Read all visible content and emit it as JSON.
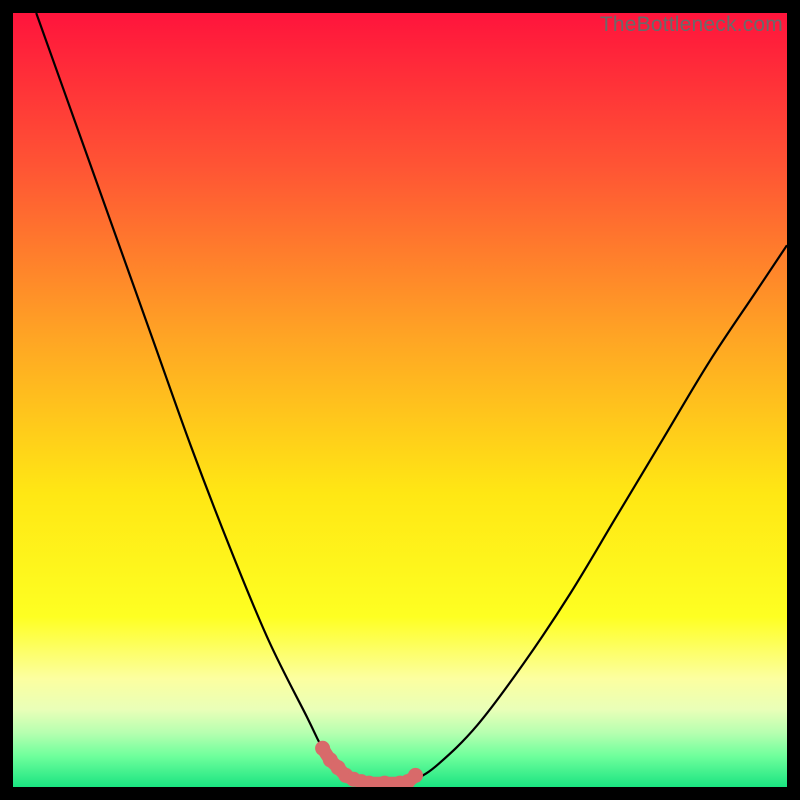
{
  "watermark": "TheBottleneck.com",
  "chart_data": {
    "type": "line",
    "title": "",
    "xlabel": "",
    "ylabel": "",
    "xlim": [
      0,
      100
    ],
    "ylim": [
      0,
      100
    ],
    "grid": false,
    "series": [
      {
        "name": "bottleneck-curve",
        "x": [
          3,
          8,
          13,
          18,
          23,
          28,
          33,
          38,
          40,
          42,
          44,
          46,
          48,
          50,
          52,
          55,
          60,
          66,
          72,
          78,
          84,
          90,
          96,
          100
        ],
        "y": [
          100,
          86,
          72,
          58,
          44,
          31,
          19,
          9,
          5,
          2.5,
          1,
          0.5,
          0.5,
          0.5,
          1,
          3,
          8,
          16,
          25,
          35,
          45,
          55,
          64,
          70
        ]
      }
    ],
    "highlight": {
      "name": "optimal-range",
      "x": [
        40,
        41,
        42,
        43,
        44,
        45,
        46,
        48,
        50,
        51,
        52
      ],
      "y": [
        5,
        3.5,
        2.5,
        1.5,
        1,
        0.7,
        0.5,
        0.5,
        0.5,
        0.7,
        1.5
      ]
    },
    "background_gradient": {
      "stops": [
        {
          "pos": 0.0,
          "color": "#ff143c"
        },
        {
          "pos": 0.2,
          "color": "#ff5534"
        },
        {
          "pos": 0.42,
          "color": "#ffa524"
        },
        {
          "pos": 0.62,
          "color": "#ffe714"
        },
        {
          "pos": 0.78,
          "color": "#feff22"
        },
        {
          "pos": 0.86,
          "color": "#fcffa0"
        },
        {
          "pos": 0.9,
          "color": "#e9ffb8"
        },
        {
          "pos": 0.93,
          "color": "#b6ffb0"
        },
        {
          "pos": 0.96,
          "color": "#6fff9c"
        },
        {
          "pos": 1.0,
          "color": "#1ae481"
        }
      ]
    },
    "curve_color": "#000000",
    "highlight_color": "#d86a6a"
  }
}
